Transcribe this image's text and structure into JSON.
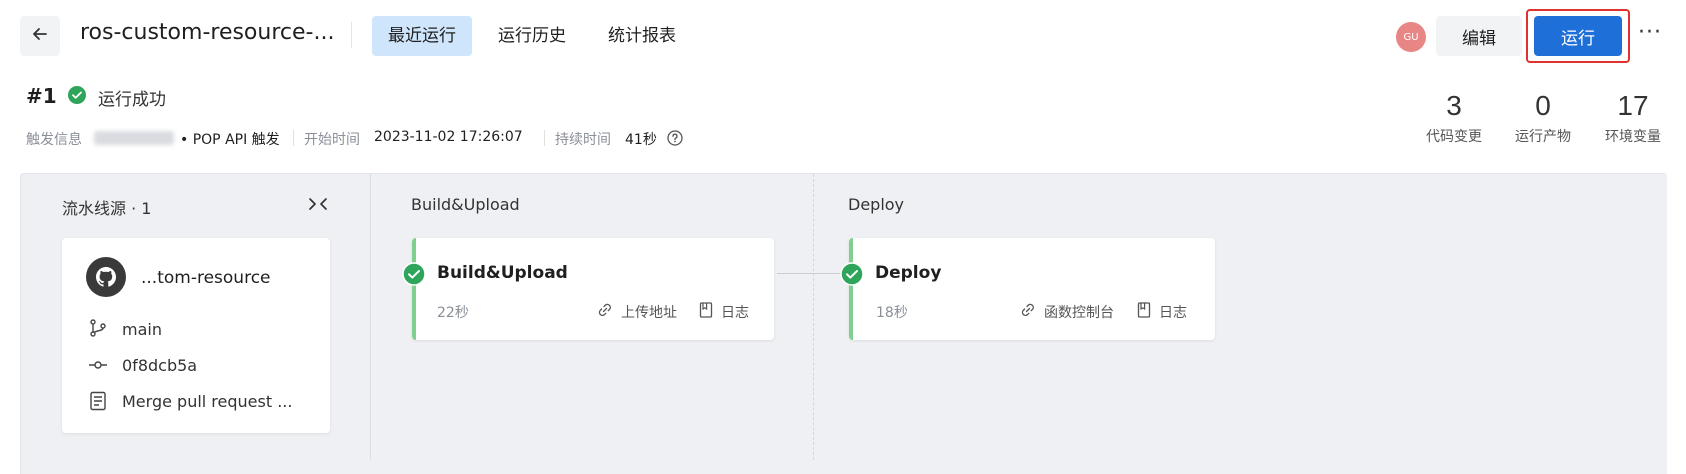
{
  "header": {
    "title": "ros-custom-resource-...",
    "tabs": [
      {
        "label": "最近运行",
        "active": true
      },
      {
        "label": "运行历史",
        "active": false
      },
      {
        "label": "统计报表",
        "active": false
      }
    ],
    "avatar_text": "GU",
    "edit_label": "编辑",
    "run_label": "运行",
    "more_label": "···"
  },
  "run": {
    "number": "#1",
    "status": "运行成功",
    "trigger_label": "触发信息",
    "trigger_value": "• POP API 触发",
    "start_label": "开始时间",
    "start_value": "2023-11-02 17:26:07",
    "duration_label": "持续时间",
    "duration_value": "41秒"
  },
  "stats": [
    {
      "value": "3",
      "label": "代码变更"
    },
    {
      "value": "0",
      "label": "运行产物"
    },
    {
      "value": "17",
      "label": "环境变量"
    }
  ],
  "source": {
    "header": "流水线源 · 1",
    "collapse_icon": "collapse-icon",
    "name": "...tom-resource",
    "branch": "main",
    "commit": "0f8dcb5a",
    "message": "Merge pull request ..."
  },
  "stages": [
    {
      "label": "Build&Upload",
      "job": {
        "title": "Build&Upload",
        "duration": "22秒",
        "link1": "上传地址",
        "link2": "日志"
      }
    },
    {
      "label": "Deploy",
      "job": {
        "title": "Deploy",
        "duration": "18秒",
        "link1": "函数控制台",
        "link2": "日志"
      }
    }
  ],
  "colors": {
    "primary": "#1f6fd9",
    "success": "#2ea55a",
    "highlight": "#e03131"
  }
}
